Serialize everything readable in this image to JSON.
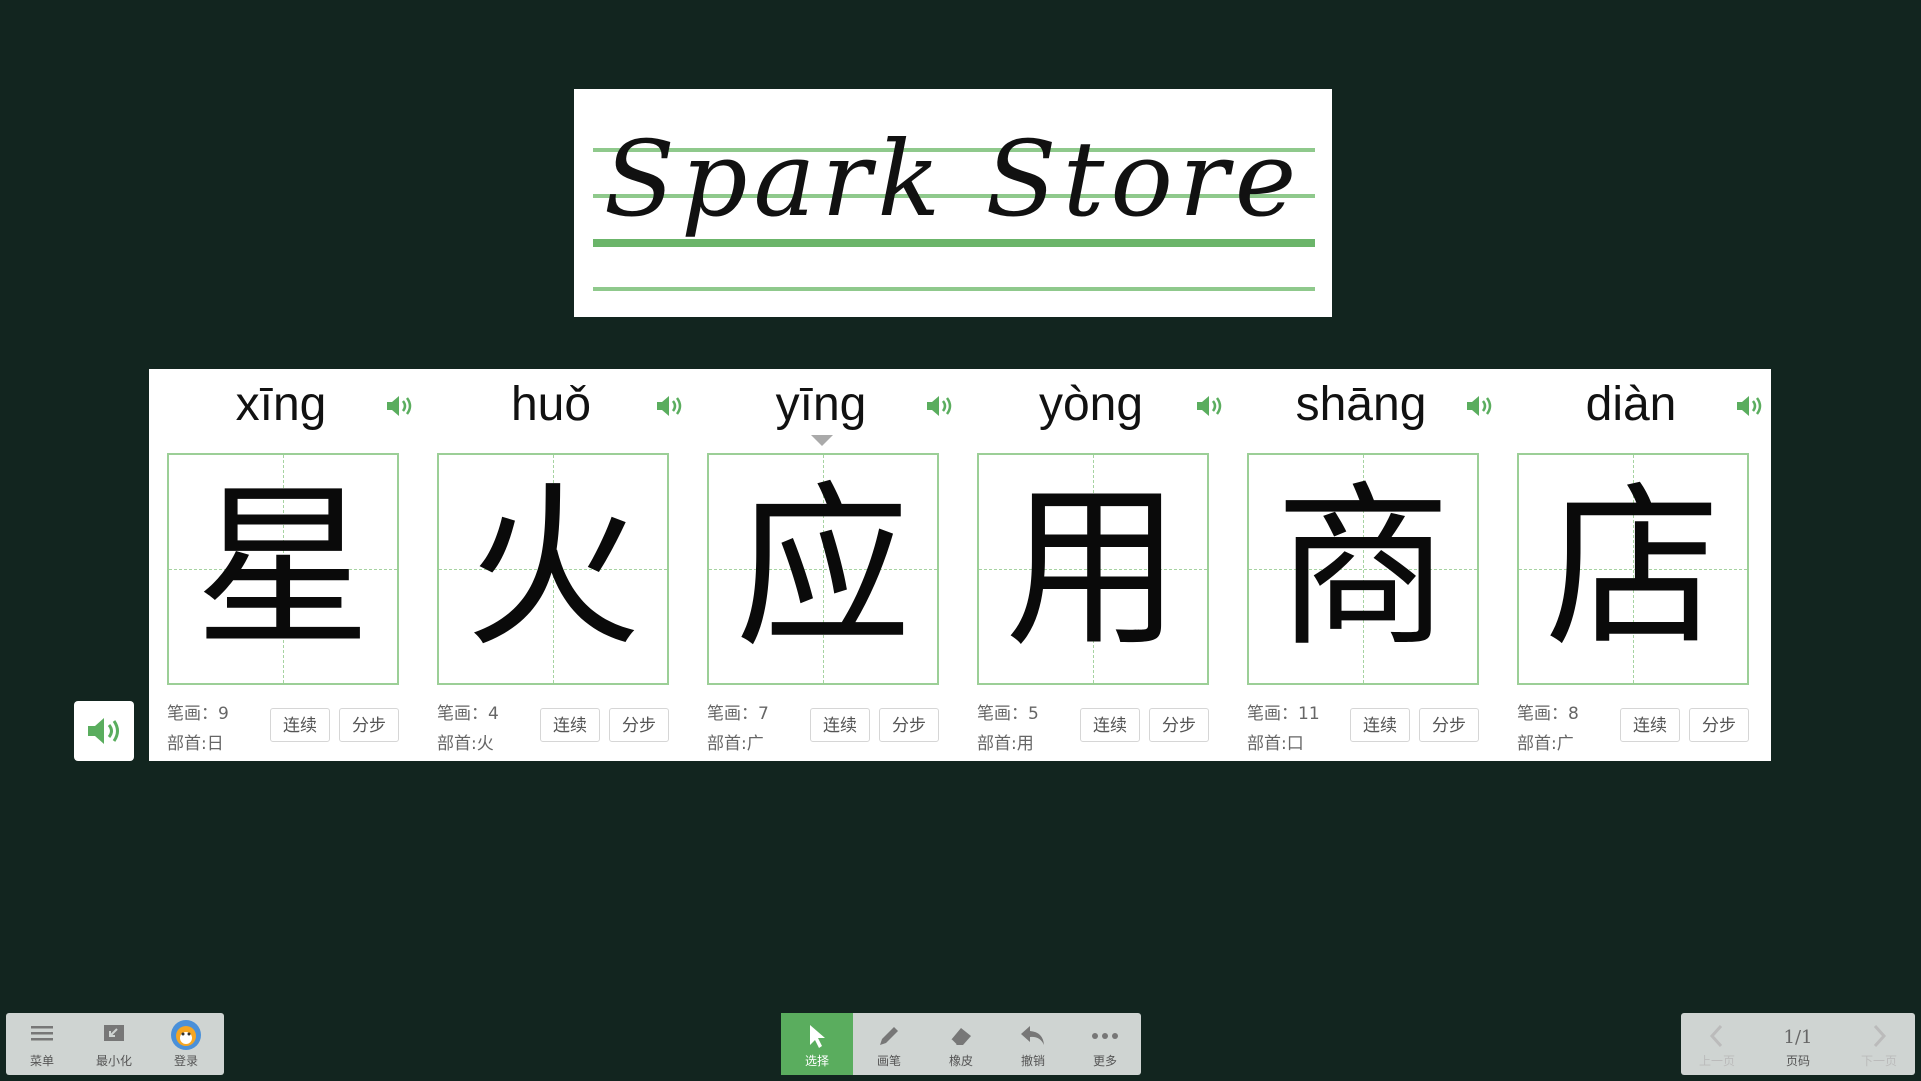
{
  "title_card": {
    "text": "Spark Store"
  },
  "characters": [
    {
      "pinyin": "xīng",
      "char": "星",
      "strokes_label": "笔画：9",
      "radical_label": "部首:日"
    },
    {
      "pinyin": "huǒ",
      "char": "火",
      "strokes_label": "笔画：4",
      "radical_label": "部首:火"
    },
    {
      "pinyin": "yīng",
      "char": "应",
      "strokes_label": "笔画：7",
      "radical_label": "部首:广"
    },
    {
      "pinyin": "yòng",
      "char": "用",
      "strokes_label": "笔画：5",
      "radical_label": "部首:用"
    },
    {
      "pinyin": "shāng",
      "char": "商",
      "strokes_label": "笔画：11",
      "radical_label": "部首:口"
    },
    {
      "pinyin": "diàn",
      "char": "店",
      "strokes_label": "笔画：8",
      "radical_label": "部首:广"
    }
  ],
  "buttons": {
    "continuous": "连续",
    "step": "分步"
  },
  "left_toolbar": {
    "menu": "菜单",
    "minimize": "最小化",
    "login": "登录"
  },
  "center_toolbar": {
    "select": "选择",
    "pen": "画笔",
    "eraser": "橡皮",
    "undo": "撤销",
    "more": "更多"
  },
  "right_toolbar": {
    "prev": "上一页",
    "page": "1/1",
    "page_label": "页码",
    "next": "下一页"
  },
  "colors": {
    "background": "#12251f",
    "accent": "#5aad5e",
    "grid": "#9ccf97"
  }
}
